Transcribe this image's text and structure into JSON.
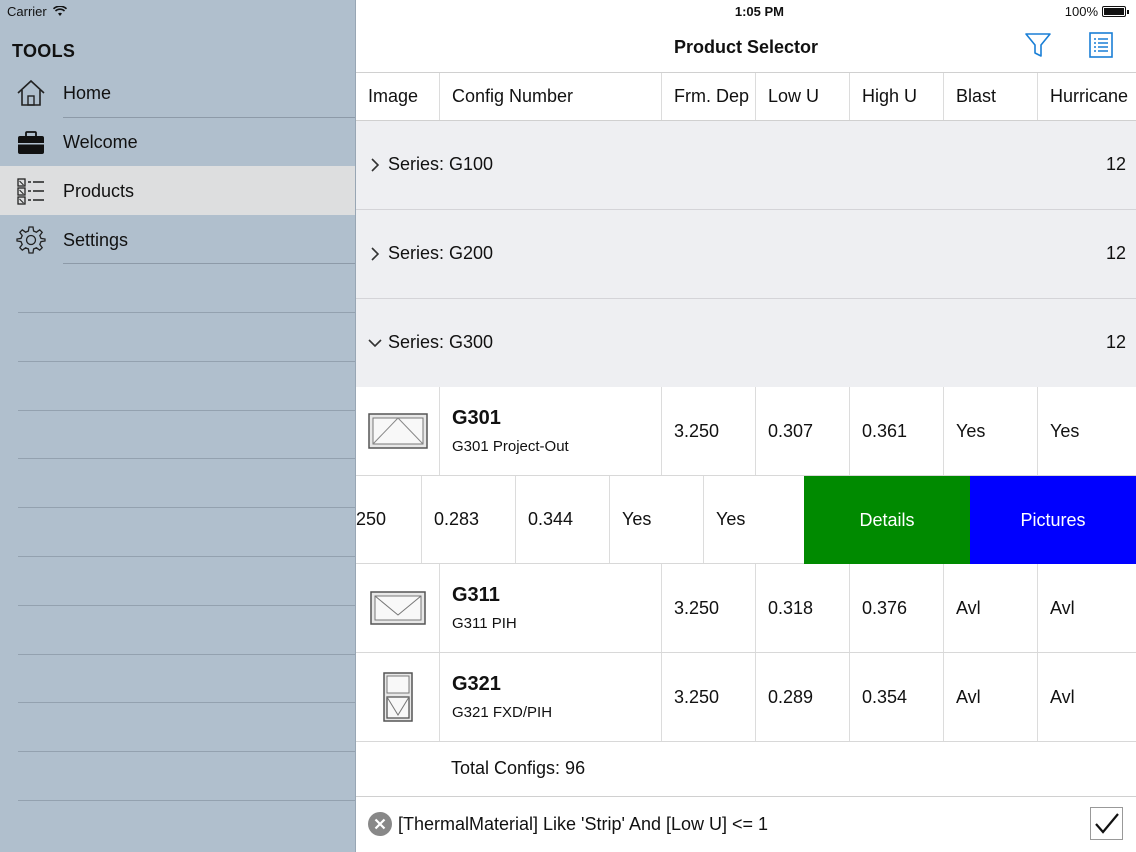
{
  "status": {
    "carrier": "Carrier",
    "time": "1:05 PM",
    "battery": "100%"
  },
  "sidebar": {
    "title": "TOOLS",
    "items": [
      {
        "label": "Home",
        "icon": "home-icon"
      },
      {
        "label": "Welcome",
        "icon": "briefcase-icon"
      },
      {
        "label": "Products",
        "icon": "product-list-icon",
        "active": true
      },
      {
        "label": "Settings",
        "icon": "gear-icon"
      }
    ]
  },
  "nav": {
    "title": "Product Selector",
    "left_action": "filter-icon",
    "right_action": "list-icon"
  },
  "table": {
    "columns": [
      "Image",
      "Config Number",
      "Frm. Dep",
      "Low U",
      "High U",
      "Blast",
      "Hurricane"
    ],
    "groups": [
      {
        "label": "Series: G100",
        "count": "12",
        "expanded": false
      },
      {
        "label": "Series: G200",
        "count": "12",
        "expanded": false
      },
      {
        "label": "Series: G300",
        "count": "12",
        "expanded": true
      }
    ],
    "rows": [
      {
        "name": "G301",
        "desc": "G301 Project-Out",
        "frm": "3.250",
        "low": "0.307",
        "high": "0.361",
        "blast": "Yes",
        "hurricane": "Yes"
      },
      {
        "name": "G311",
        "desc": "G311 PIH",
        "frm": "3.250",
        "low": "0.318",
        "high": "0.376",
        "blast": "Avl",
        "hurricane": "Avl"
      },
      {
        "name": "G321",
        "desc": "G321 FXD/PIH",
        "frm": "3.250",
        "low": "0.289",
        "high": "0.354",
        "blast": "Avl",
        "hurricane": "Avl"
      }
    ],
    "swiped_row": {
      "frm": "250",
      "low": "0.283",
      "high": "0.344",
      "blast": "Yes",
      "hurricane": "Yes",
      "details_label": "Details",
      "pictures_label": "Pictures"
    }
  },
  "footer": {
    "total": "Total Configs: 96",
    "filter": "[ThermalMaterial] Like 'Strip' And [Low U] <= 1"
  },
  "colors": {
    "sidebar": "#b0bfcd",
    "details": "#008a00",
    "pictures": "#0000ff",
    "group_bg": "#eeeff2",
    "accent": "#1a7fd6"
  }
}
